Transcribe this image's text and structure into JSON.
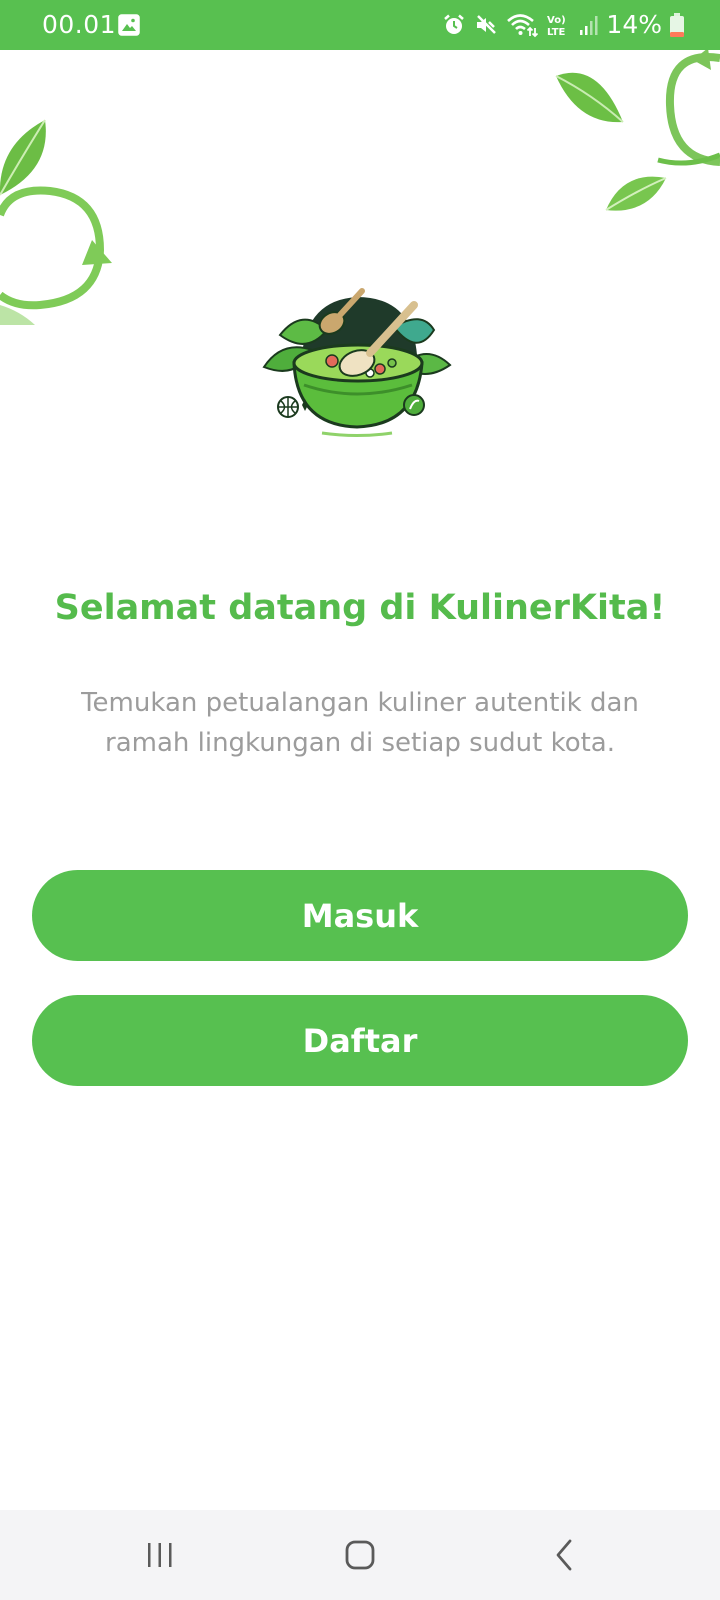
{
  "status_bar": {
    "time": "00.01",
    "battery_percent": "14%",
    "battery_level": 0.14,
    "icons": [
      "gallery-icon",
      "alarm-icon",
      "mute-icon",
      "wifi-icon",
      "volte-icon",
      "signal-icon",
      "battery-icon"
    ],
    "background_color": "#58c050"
  },
  "welcome": {
    "title": "Selamat datang di KulinerKita!",
    "subtitle": "Temukan petualangan kuliner autentik dan ramah lingkungan di setiap sudut kota."
  },
  "buttons": {
    "login_label": "Masuk",
    "register_label": "Daftar"
  },
  "nav_bar": {
    "icons": [
      "recent-apps-icon",
      "home-icon",
      "back-icon"
    ]
  },
  "colors": {
    "accent": "#57c050",
    "title": "#55bb4c",
    "subtitle": "#9c9c9c"
  }
}
